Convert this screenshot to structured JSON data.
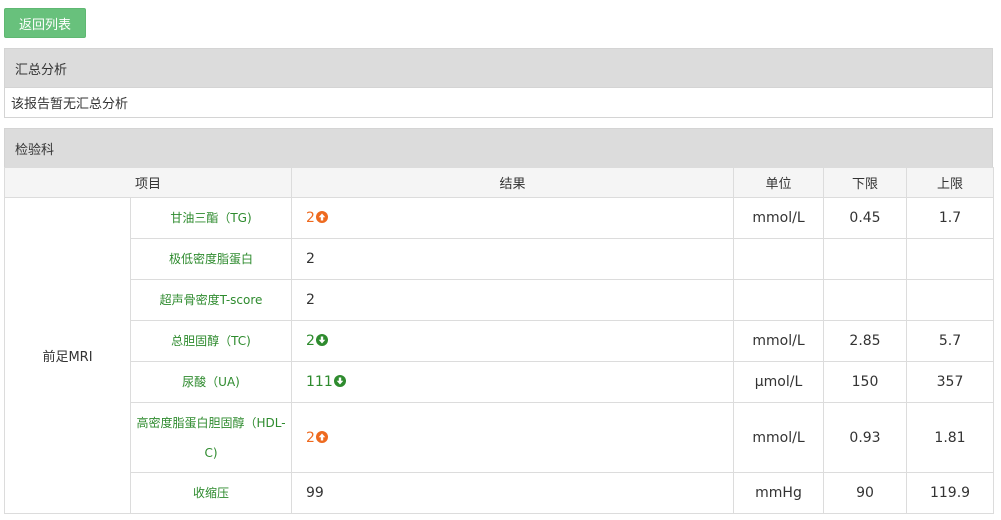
{
  "back_button": "返回列表",
  "summary": {
    "title": "汇总分析",
    "text": "该报告暂无汇总分析"
  },
  "department": {
    "title": "检验科"
  },
  "table": {
    "headers": [
      "项目",
      "结果",
      "单位",
      "下限",
      "上限"
    ],
    "group_label": "前足MRI",
    "rows": [
      {
        "item": "甘油三酯（TG)",
        "result": "2",
        "flag": "up",
        "unit": "mmol/L",
        "low": "0.45",
        "high": "1.7"
      },
      {
        "item": "极低密度脂蛋白",
        "result": "2",
        "flag": "",
        "unit": "",
        "low": "",
        "high": ""
      },
      {
        "item": "超声骨密度T-score",
        "result": "2",
        "flag": "",
        "unit": "",
        "low": "",
        "high": ""
      },
      {
        "item": "总胆固醇（TC)",
        "result": "2",
        "flag": "down",
        "unit": "mmol/L",
        "low": "2.85",
        "high": "5.7"
      },
      {
        "item": "尿酸（UA)",
        "result": "111",
        "flag": "down",
        "unit": "μmol/L",
        "low": "150",
        "high": "357"
      },
      {
        "item": "高密度脂蛋白胆固醇（HDL-C)",
        "result": "2",
        "flag": "up",
        "unit": "mmol/L",
        "low": "0.93",
        "high": "1.81"
      },
      {
        "item": "收缩压",
        "result": "99",
        "flag": "",
        "unit": "mmHg",
        "low": "90",
        "high": "119.9"
      }
    ]
  },
  "icons": {
    "up": "arrow-up-circle-icon",
    "down": "arrow-down-circle-icon"
  },
  "colors": {
    "button": "#68c17c",
    "item_text": "#2e8b2e",
    "flag_up": "#ee6a1f",
    "flag_down": "#2e8b2e"
  }
}
